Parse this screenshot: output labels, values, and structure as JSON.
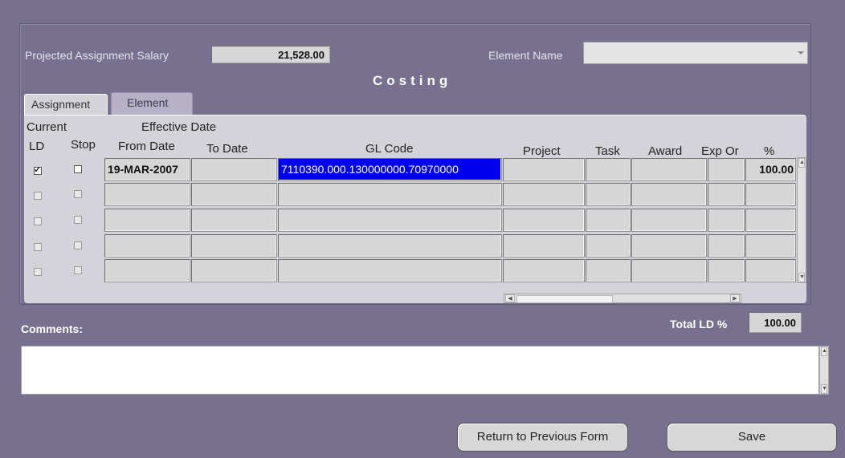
{
  "header": {
    "salary_label": "Projected Assignment Salary",
    "salary_value": "21,528.00",
    "element_name_label": "Element Name",
    "element_name_value": "",
    "title": "Costing"
  },
  "tabs": [
    {
      "label": "Assignment",
      "active": true
    },
    {
      "label": "Element",
      "active": false
    }
  ],
  "table": {
    "group_headers": {
      "current": "Current",
      "effective_date": "Effective Date"
    },
    "columns": {
      "ld": "LD",
      "stop": "Stop",
      "from_date": "From Date",
      "to_date": "To Date",
      "gl_code": "GL Code",
      "project": "Project",
      "task": "Task",
      "award": "Award",
      "exp_org": "Exp Or",
      "pct": "%"
    },
    "rows": [
      {
        "ld": true,
        "stop": false,
        "from_date": "19-MAR-2007",
        "to_date": "",
        "gl_code": "7110390.000.130000000.70970000",
        "project": "",
        "task": "",
        "award": "",
        "exp_org": "",
        "pct": "100.00"
      },
      {
        "ld": false,
        "stop": false,
        "from_date": "",
        "to_date": "",
        "gl_code": "",
        "project": "",
        "task": "",
        "award": "",
        "exp_org": "",
        "pct": ""
      },
      {
        "ld": false,
        "stop": false,
        "from_date": "",
        "to_date": "",
        "gl_code": "",
        "project": "",
        "task": "",
        "award": "",
        "exp_org": "",
        "pct": ""
      },
      {
        "ld": false,
        "stop": false,
        "from_date": "",
        "to_date": "",
        "gl_code": "",
        "project": "",
        "task": "",
        "award": "",
        "exp_org": "",
        "pct": ""
      },
      {
        "ld": false,
        "stop": false,
        "from_date": "",
        "to_date": "",
        "gl_code": "",
        "project": "",
        "task": "",
        "award": "",
        "exp_org": "",
        "pct": ""
      }
    ]
  },
  "totals": {
    "label": "Total LD %",
    "value": "100.00"
  },
  "comments": {
    "label": "Comments:",
    "value": ""
  },
  "buttons": {
    "return": "Return to Previous Form",
    "save": "Save"
  },
  "icons": {
    "scroll_up": "arrow-up-icon",
    "scroll_down": "arrow-down-icon",
    "scroll_left": "arrow-left-icon",
    "scroll_right": "arrow-right-icon",
    "dropdown": "chevron-down-icon"
  },
  "colors": {
    "background": "#77708f",
    "selection": "#0000ee",
    "field": "#d6d6d6"
  }
}
